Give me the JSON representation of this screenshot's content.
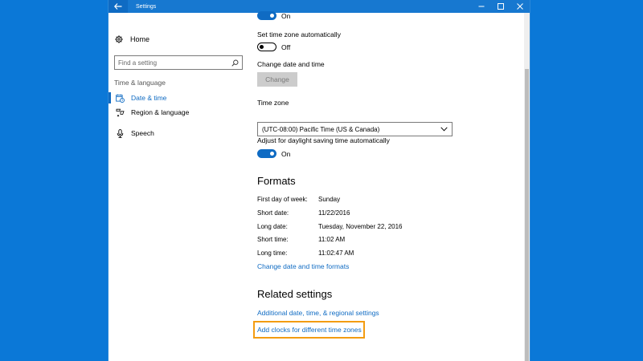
{
  "window": {
    "title": "Settings",
    "back_icon": "arrow-left-icon",
    "controls": [
      "minimize",
      "maximize",
      "close"
    ]
  },
  "sidebar": {
    "home_label": "Home",
    "search_placeholder": "Find a setting",
    "section_label": "Time & language",
    "items": [
      {
        "label": "Date & time",
        "icon": "calendar-clock-icon",
        "active": true
      },
      {
        "label": "Region & language",
        "icon": "region-icon",
        "active": false
      },
      {
        "label": "Speech",
        "icon": "microphone-icon",
        "active": false
      }
    ]
  },
  "content": {
    "set_time_auto_state": "On",
    "set_tz_auto_label": "Set time zone automatically",
    "set_tz_auto_state": "Off",
    "change_dt_label": "Change date and time",
    "change_button": "Change",
    "time_zone_label": "Time zone",
    "time_zone_value": "(UTC-08:00) Pacific Time (US & Canada)",
    "dst_label": "Adjust for daylight saving time automatically",
    "dst_state": "On",
    "formats_heading": "Formats",
    "formats": [
      {
        "key": "First day of week:",
        "value": "Sunday"
      },
      {
        "key": "Short date:",
        "value": "11/22/2016"
      },
      {
        "key": "Long date:",
        "value": "Tuesday, November 22, 2016"
      },
      {
        "key": "Short time:",
        "value": "11:02 AM"
      },
      {
        "key": "Long time:",
        "value": "11:02:47 AM"
      }
    ],
    "change_formats_link": "Change date and time formats",
    "related_heading": "Related settings",
    "related_links": [
      "Additional date, time, & regional settings",
      "Add clocks for different time zones"
    ]
  },
  "colors": {
    "desktop": "#0b78d7",
    "accent": "#0f6bc3",
    "highlight": "#f39c12"
  }
}
